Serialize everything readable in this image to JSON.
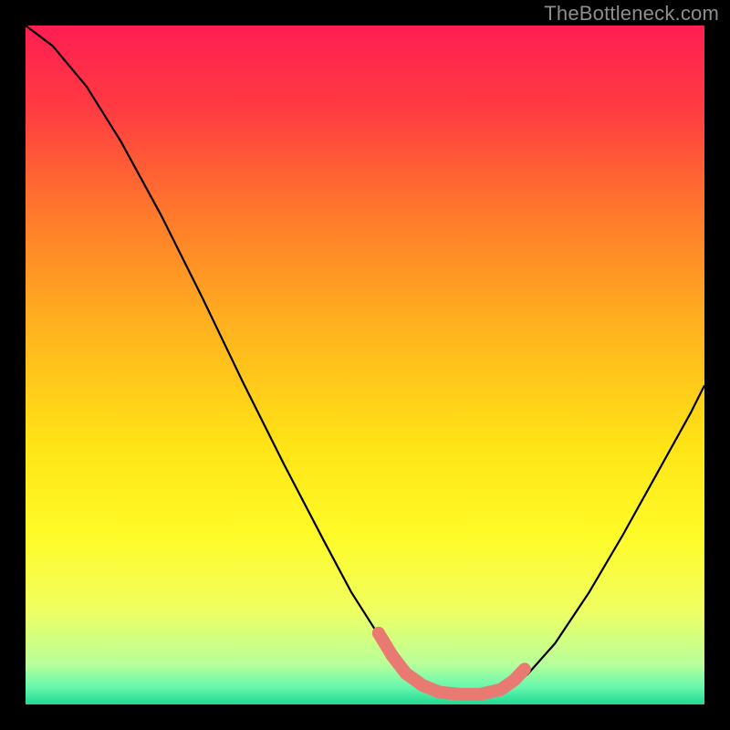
{
  "watermark": "TheBottleneck.com",
  "chart_data": {
    "type": "line",
    "title": "",
    "xlabel": "",
    "ylabel": "",
    "xlim": [
      0,
      100
    ],
    "ylim": [
      0,
      100
    ],
    "background_gradient_stops": [
      {
        "offset": 0.0,
        "color": "#ff1e52"
      },
      {
        "offset": 0.12,
        "color": "#ff3a42"
      },
      {
        "offset": 0.28,
        "color": "#ff7a2b"
      },
      {
        "offset": 0.45,
        "color": "#ffb41e"
      },
      {
        "offset": 0.62,
        "color": "#ffe416"
      },
      {
        "offset": 0.75,
        "color": "#fffb28"
      },
      {
        "offset": 0.86,
        "color": "#f0ff60"
      },
      {
        "offset": 0.94,
        "color": "#b9ff9a"
      },
      {
        "offset": 0.975,
        "color": "#66f7ad"
      },
      {
        "offset": 1.0,
        "color": "#1fd992"
      }
    ],
    "series": [
      {
        "name": "bottleneck-curve",
        "stroke": "#000000",
        "stroke_width": 2.2,
        "x": [
          0.0,
          4.0,
          9.0,
          14.0,
          20.0,
          26.0,
          32.0,
          38.0,
          44.0,
          48.0,
          51.5,
          54.0,
          57.0,
          60.5,
          64.0,
          68.0,
          71.5,
          74.0,
          78.0,
          83.0,
          88.0,
          93.0,
          98.0,
          100.0
        ],
        "values": [
          100.0,
          97.0,
          91.0,
          83.0,
          72.0,
          60.0,
          47.5,
          35.5,
          24.0,
          16.5,
          11.0,
          7.5,
          4.5,
          2.5,
          1.5,
          1.3,
          2.5,
          4.5,
          9.0,
          16.5,
          25.0,
          34.0,
          43.0,
          47.0
        ]
      },
      {
        "name": "optimal-band-marker",
        "stroke": "#e97a72",
        "stroke_width": 14,
        "linecap": "round",
        "x": [
          52.0,
          54.0,
          56.0,
          58.5,
          61.0,
          64.0,
          67.0,
          70.0,
          72.0,
          73.5
        ],
        "values": [
          10.5,
          7.2,
          4.6,
          2.8,
          1.8,
          1.5,
          1.5,
          2.2,
          3.6,
          5.2
        ]
      }
    ]
  }
}
